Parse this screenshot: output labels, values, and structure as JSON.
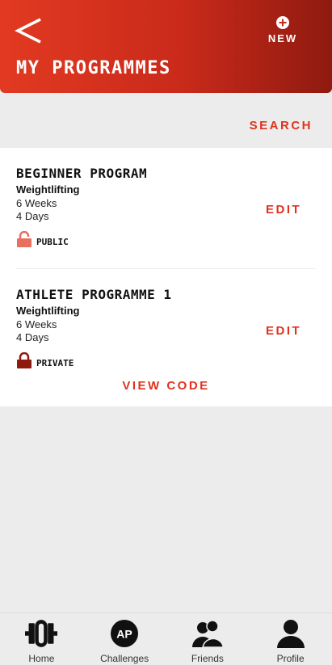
{
  "header": {
    "title": "MY PROGRAMMES",
    "new_label": "NEW"
  },
  "search_label": "SEARCH",
  "programmes": [
    {
      "title": "BEGINNER PROGRAM",
      "type": "Weightlifting",
      "weeks": "6 Weeks",
      "days": "4 Days",
      "access": "PUBLIC",
      "edit_label": "EDIT"
    },
    {
      "title": "ATHLETE PROGRAMME 1",
      "type": "Weightlifting",
      "weeks": "6 Weeks",
      "days": "4 Days",
      "access": "PRIVATE",
      "edit_label": "EDIT"
    }
  ],
  "view_code_label": "VIEW CODE",
  "nav": {
    "items": [
      {
        "label": "Home",
        "icon": "barbell-icon"
      },
      {
        "label": "Challenges",
        "icon": "ap-badge-icon"
      },
      {
        "label": "Friends",
        "icon": "friends-icon"
      },
      {
        "label": "Profile",
        "icon": "profile-icon"
      }
    ],
    "ap_badge_text": "AP"
  },
  "colors": {
    "accent": "#e0321e",
    "header_start": "#e23a22",
    "header_end": "#8f1a10",
    "public_lock": "#e87060",
    "private_lock": "#8f1a10"
  }
}
